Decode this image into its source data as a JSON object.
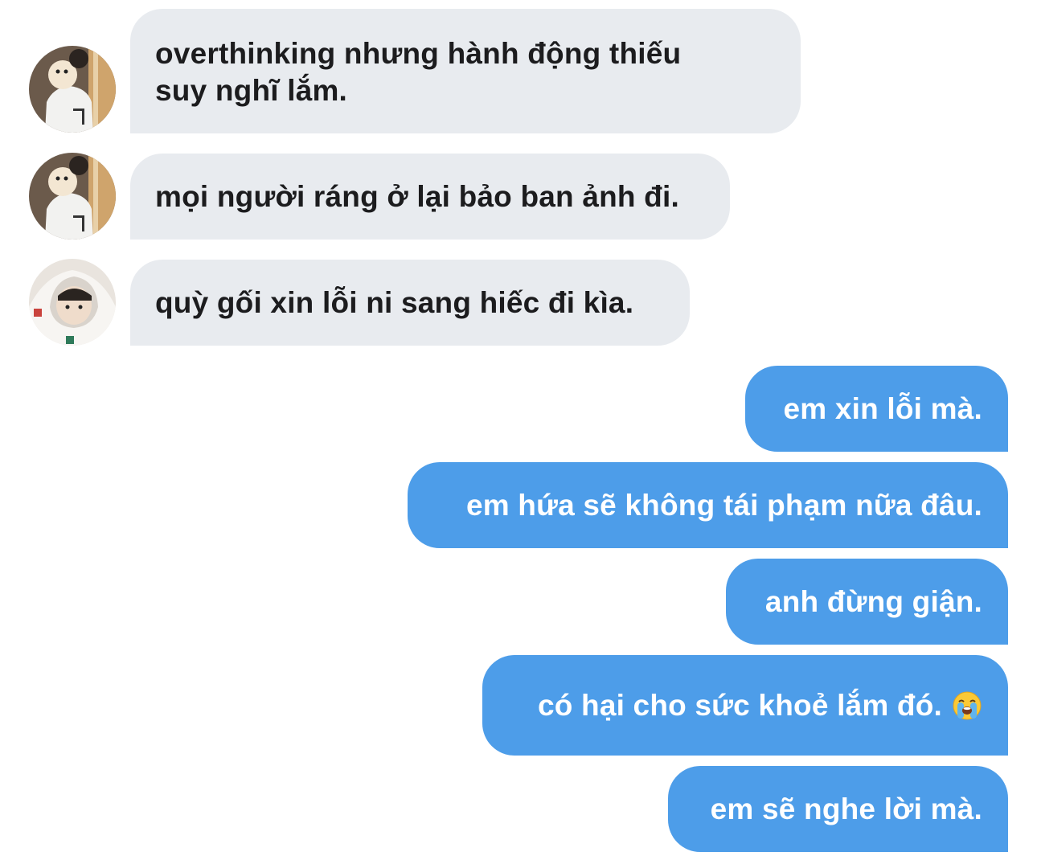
{
  "messages": [
    {
      "direction": "incoming",
      "avatar": "avatar-person-holding-dog",
      "lines": [
        "overthinking nhưng hành động thiếu",
        "suy nghĩ lắm."
      ]
    },
    {
      "direction": "incoming",
      "avatar": "avatar-person-holding-dog",
      "text": "mọi người ráng ở lại bảo ban ảnh đi."
    },
    {
      "direction": "incoming",
      "avatar": "avatar-person-in-hoodie",
      "text": "quỳ gối xin lỗi ni sang hiếc đi kìa."
    },
    {
      "direction": "outgoing",
      "text": "em xin lỗi mà."
    },
    {
      "direction": "outgoing",
      "text": "em hứa sẽ không tái phạm nữa đâu."
    },
    {
      "direction": "outgoing",
      "text": "anh đừng giận."
    },
    {
      "direction": "outgoing",
      "text": "có hại cho sức khoẻ lắm đó.",
      "emoji": "loudly-crying-face-emoji"
    },
    {
      "direction": "outgoing",
      "text": "em sẽ nghe lời mà."
    }
  ],
  "colors": {
    "incoming_bubble": "#e8ebef",
    "incoming_text": "#1c1c1e",
    "outgoing_bubble": "#4d9de9",
    "outgoing_text": "#ffffff",
    "background": "#ffffff"
  }
}
